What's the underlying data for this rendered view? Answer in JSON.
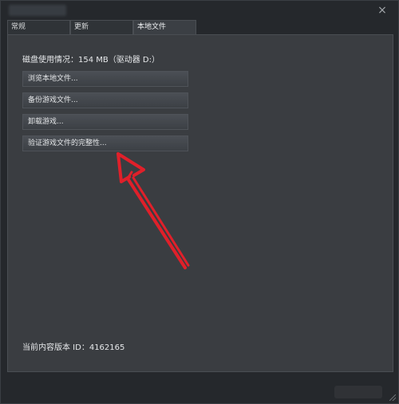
{
  "window": {
    "close_icon": "×"
  },
  "tabs": [
    {
      "label": "常规"
    },
    {
      "label": "更新"
    },
    {
      "label": "本地文件"
    }
  ],
  "local_files": {
    "disk_usage": "磁盘使用情况：154 MB（驱动器 D:）",
    "buttons": [
      {
        "label": "浏览本地文件..."
      },
      {
        "label": "备份游戏文件..."
      },
      {
        "label": "卸载游戏..."
      },
      {
        "label": "验证游戏文件的完整性..."
      }
    ],
    "content_id": "当前内容版本 ID：4162165"
  },
  "colors": {
    "window_bg": "#25282c",
    "panel_bg": "#3a3d41",
    "button_bg": "#43474c",
    "annotation_arrow": "#e0202a"
  },
  "icons": {
    "close": "close-icon",
    "resize": "resize-grip-icon"
  }
}
